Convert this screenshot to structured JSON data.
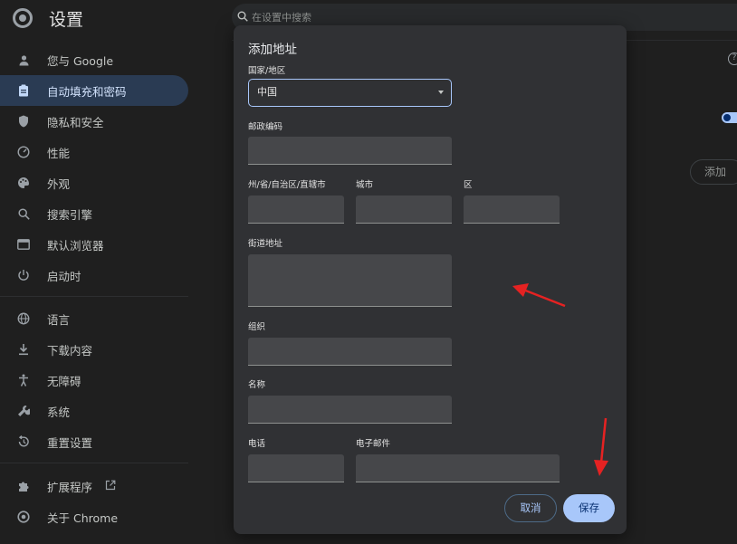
{
  "app": {
    "title": "设置"
  },
  "search": {
    "placeholder": "在设置中搜索"
  },
  "sidebar": {
    "items": [
      {
        "label": "您与 Google",
        "icon": "person-icon"
      },
      {
        "label": "自动填充和密码",
        "icon": "clipboard-icon",
        "active": true
      },
      {
        "label": "隐私和安全",
        "icon": "shield-icon"
      },
      {
        "label": "性能",
        "icon": "speedometer-icon"
      },
      {
        "label": "外观",
        "icon": "palette-icon"
      },
      {
        "label": "搜索引擎",
        "icon": "search-icon"
      },
      {
        "label": "默认浏览器",
        "icon": "browser-icon"
      },
      {
        "label": "启动时",
        "icon": "power-icon"
      },
      {
        "label": "语言",
        "icon": "globe-icon"
      },
      {
        "label": "下载内容",
        "icon": "download-icon"
      },
      {
        "label": "无障碍",
        "icon": "accessibility-icon"
      },
      {
        "label": "系统",
        "icon": "wrench-icon"
      },
      {
        "label": "重置设置",
        "icon": "reset-icon"
      },
      {
        "label": "扩展程序",
        "icon": "puzzle-icon"
      },
      {
        "label": "关于 Chrome",
        "icon": "chrome-icon"
      }
    ]
  },
  "background": {
    "add_label": "添加"
  },
  "dialog": {
    "title": "添加地址",
    "country_label": "国家/地区",
    "country_value": "中国",
    "postal_label": "邮政编码",
    "state_label": "州/省/自治区/直辖市",
    "city_label": "城市",
    "district_label": "区",
    "street_label": "街道地址",
    "org_label": "组织",
    "name_label": "名称",
    "phone_label": "电话",
    "email_label": "电子邮件",
    "cancel_label": "取消",
    "save_label": "保存"
  },
  "colors": {
    "accent": "#a8c7fa",
    "annotation_arrow": "#e52222"
  }
}
